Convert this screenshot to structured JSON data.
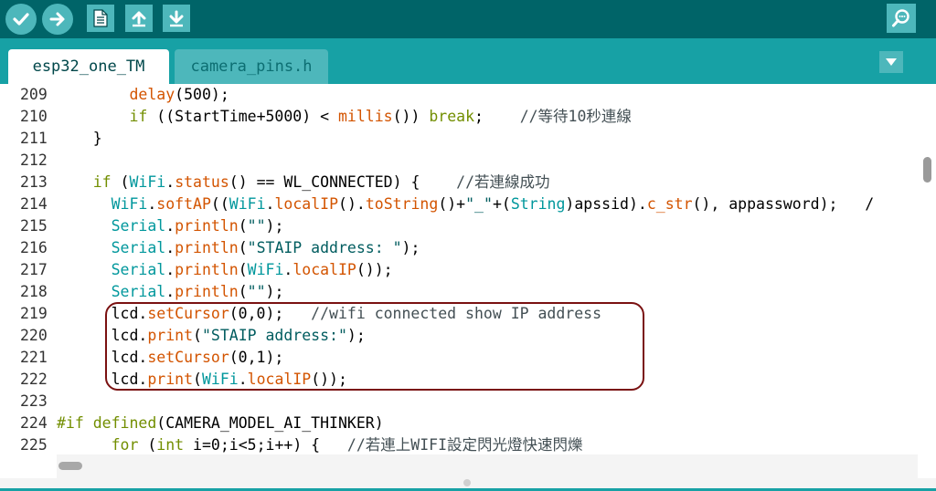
{
  "toolbar": {
    "buttons": [
      {
        "name": "verify",
        "icon": "check-icon"
      },
      {
        "name": "upload",
        "icon": "arrow-right-icon"
      },
      {
        "name": "new",
        "icon": "new-file-icon"
      },
      {
        "name": "open",
        "icon": "arrow-up-icon"
      },
      {
        "name": "save",
        "icon": "arrow-down-icon"
      }
    ],
    "serial_monitor_icon": "magnifier-icon"
  },
  "tabs": [
    {
      "label": "esp32_one_TM",
      "active": true
    },
    {
      "label": "camera_pins.h",
      "active": false
    }
  ],
  "editor": {
    "line_numbers": [
      "209",
      "210",
      "211",
      "212",
      "213",
      "214",
      "215",
      "216",
      "217",
      "218",
      "219",
      "220",
      "221",
      "222",
      "223",
      "224",
      "225"
    ],
    "lines": [
      "        delay(500);",
      "        if ((StartTime+5000) < millis()) break;    //等待10秒連線",
      "    }",
      "",
      "    if (WiFi.status() == WL_CONNECTED) {    //若連線成功",
      "      WiFi.softAP((WiFi.localIP().toString()+\"_\"+(String)apssid).c_str(), appassword);   /",
      "      Serial.println(\"\");",
      "      Serial.println(\"STAIP address: \");",
      "      Serial.println(WiFi.localIP());",
      "      Serial.println(\"\");",
      "      lcd.setCursor(0,0);   //wifi connected show IP address",
      "      lcd.print(\"STAIP address:\");",
      "      lcd.setCursor(0,1);",
      "      lcd.print(WiFi.localIP());",
      "",
      "#if defined(CAMERA_MODEL_AI_THINKER)",
      "      for (int i=0;i<5;i++) {   //若連上WIFI設定閃光燈快速閃爍"
    ]
  },
  "colors": {
    "toolbar_bg": "#006468",
    "tabbar_bg": "#17a1a5",
    "button_bg": "#4db7bb",
    "keyword": "#728e00",
    "function": "#d35400",
    "type": "#00979c",
    "string": "#005c5f",
    "comment": "#434f54",
    "highlight_border": "#7a1111"
  }
}
